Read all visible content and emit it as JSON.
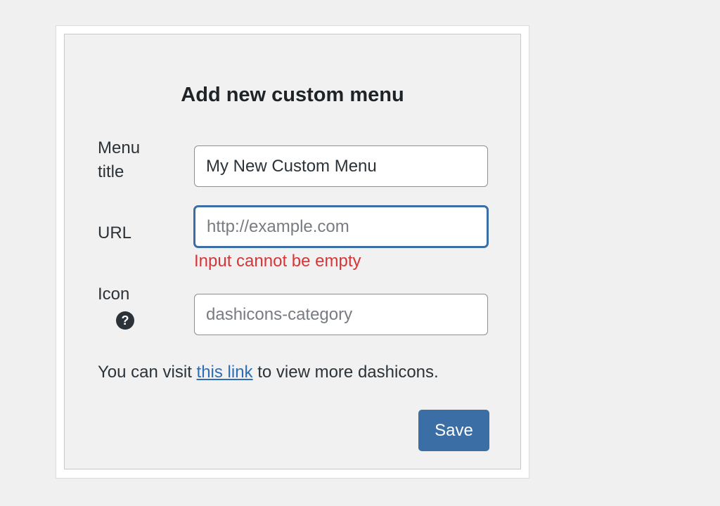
{
  "dialog": {
    "title": "Add new custom menu"
  },
  "fields": {
    "menu_title": {
      "label": "Menu title",
      "value": "My New Custom Menu"
    },
    "url": {
      "label": "URL",
      "value": "",
      "placeholder": "http://example.com",
      "error": "Input cannot be empty"
    },
    "icon": {
      "label": "Icon",
      "value": "",
      "placeholder": "dashicons-category",
      "help_glyph": "?"
    }
  },
  "hint": {
    "before": "You can visit ",
    "link_text": "this link",
    "after": " to view more dashicons."
  },
  "actions": {
    "save_label": "Save"
  },
  "colors": {
    "accent": "#3a6ea5",
    "error": "#d63638",
    "link": "#2f6db3"
  }
}
